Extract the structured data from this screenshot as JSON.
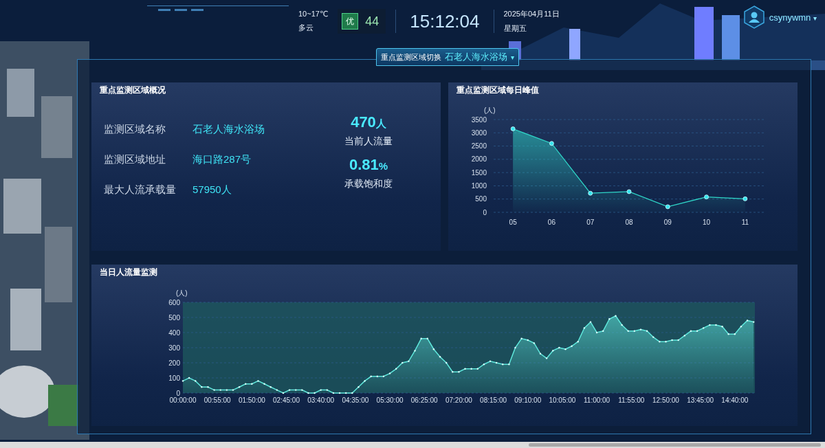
{
  "header": {
    "weather": {
      "temperature": "10~17℃",
      "condition": "多云"
    },
    "air_quality": {
      "grade": "优",
      "index": "44"
    },
    "time": "15:12:04",
    "date": "2025年04月11日",
    "weekday": "星期五",
    "user": {
      "name": "csynywmn",
      "caret": "▾"
    }
  },
  "area_switch": {
    "label": "重点监测区域切换",
    "value": "石老人海水浴场",
    "caret": "▾"
  },
  "overview": {
    "title": "重点监测区域概况",
    "fields": [
      {
        "label": "监测区域名称",
        "value": "石老人海水浴场"
      },
      {
        "label": "监测区域地址",
        "value": "海口路287号"
      },
      {
        "label": "最大人流承载量",
        "value": "57950人"
      }
    ],
    "stats": [
      {
        "value": "470",
        "unit": "人",
        "label": "当前人流量"
      },
      {
        "value": "0.81",
        "unit": "%",
        "label": "承载饱和度"
      }
    ]
  },
  "daily_peak": {
    "title": "重点监测区域每日峰值",
    "chart_data": {
      "type": "area",
      "grid": true,
      "ylabel": "(人)",
      "categories": [
        "05",
        "06",
        "07",
        "08",
        "09",
        "10",
        "11"
      ],
      "ylim": [
        0,
        3500
      ],
      "yticks": [
        0,
        500,
        1000,
        1500,
        2000,
        2500,
        3000,
        3500
      ],
      "series": [
        {
          "color": "#2fd6c8",
          "values": [
            3150,
            2600,
            720,
            780,
            210,
            580,
            510
          ]
        }
      ]
    }
  },
  "today_flow": {
    "title": "当日人流量监测",
    "chart_data": {
      "type": "area",
      "grid": true,
      "ylabel": "(人)",
      "xlim": [
        0,
        912
      ],
      "ylim": [
        0,
        600
      ],
      "yticks": [
        0,
        100,
        200,
        300,
        400,
        500,
        600
      ],
      "xticks": [
        {
          "value": 0,
          "label": "00:00:00"
        },
        {
          "value": 55,
          "label": "00:55:00"
        },
        {
          "value": 110,
          "label": "01:50:00"
        },
        {
          "value": 165,
          "label": "02:45:00"
        },
        {
          "value": 220,
          "label": "03:40:00"
        },
        {
          "value": 275,
          "label": "04:35:00"
        },
        {
          "value": 330,
          "label": "05:30:00"
        },
        {
          "value": 385,
          "label": "06:25:00"
        },
        {
          "value": 440,
          "label": "07:20:00"
        },
        {
          "value": 495,
          "label": "08:15:00"
        },
        {
          "value": 550,
          "label": "09:10:00"
        },
        {
          "value": 605,
          "label": "10:05:00"
        },
        {
          "value": 660,
          "label": "11:00:00"
        },
        {
          "value": 715,
          "label": "11:55:00"
        },
        {
          "value": 770,
          "label": "12:50:00"
        },
        {
          "value": 825,
          "label": "13:45:00"
        },
        {
          "value": 880,
          "label": "14:40:00"
        }
      ],
      "x": [
        0,
        10,
        20,
        30,
        40,
        50,
        60,
        70,
        80,
        90,
        100,
        110,
        120,
        130,
        140,
        150,
        160,
        170,
        180,
        190,
        200,
        210,
        220,
        230,
        240,
        250,
        260,
        270,
        280,
        290,
        300,
        310,
        320,
        330,
        340,
        350,
        360,
        370,
        380,
        390,
        400,
        410,
        420,
        430,
        440,
        450,
        460,
        470,
        480,
        490,
        500,
        510,
        520,
        530,
        540,
        550,
        560,
        570,
        580,
        590,
        600,
        610,
        620,
        630,
        640,
        650,
        660,
        670,
        680,
        690,
        700,
        710,
        720,
        730,
        740,
        750,
        760,
        770,
        780,
        790,
        800,
        810,
        820,
        830,
        840,
        850,
        860,
        870,
        880,
        890,
        900,
        910
      ],
      "series": [
        {
          "color": "#5fe8dc",
          "values": [
            80,
            100,
            80,
            40,
            40,
            20,
            20,
            20,
            20,
            40,
            60,
            60,
            80,
            60,
            40,
            20,
            0,
            20,
            20,
            20,
            0,
            0,
            20,
            20,
            0,
            0,
            0,
            0,
            40,
            80,
            110,
            110,
            110,
            130,
            160,
            200,
            210,
            280,
            360,
            360,
            290,
            240,
            200,
            140,
            140,
            160,
            160,
            160,
            190,
            210,
            200,
            190,
            190,
            300,
            360,
            350,
            330,
            260,
            230,
            280,
            300,
            290,
            310,
            340,
            430,
            470,
            400,
            410,
            490,
            510,
            450,
            410,
            410,
            420,
            410,
            370,
            340,
            340,
            350,
            350,
            380,
            410,
            410,
            430,
            450,
            450,
            440,
            390,
            390,
            440,
            480,
            470
          ]
        }
      ]
    }
  }
}
